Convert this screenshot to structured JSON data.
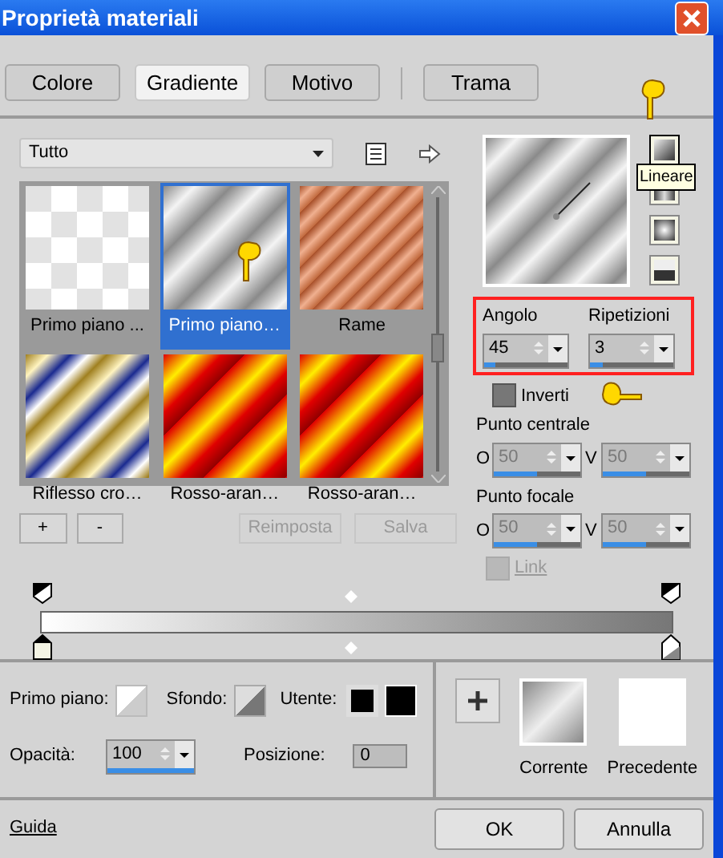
{
  "window": {
    "title": "Proprietà materiali"
  },
  "tabs": [
    {
      "label": "Colore",
      "selected": false
    },
    {
      "label": "Gradiente",
      "selected": true
    },
    {
      "label": "Motivo",
      "selected": false
    },
    {
      "label": "Trama",
      "selected": false
    }
  ],
  "category_dropdown": {
    "value": "Tutto"
  },
  "gradients": [
    {
      "label": "Primo piano ...",
      "selected": false,
      "kind": "checker"
    },
    {
      "label": "Primo piano…",
      "selected": true,
      "kind": "silver"
    },
    {
      "label": "Rame",
      "selected": false,
      "kind": "copper"
    },
    {
      "label": "Riflesso cro…",
      "selected": false,
      "kind": "chrome"
    },
    {
      "label": "Rosso-aran…",
      "selected": false,
      "kind": "fire"
    },
    {
      "label": "Rosso-aran…",
      "selected": false,
      "kind": "fire"
    }
  ],
  "gallery_buttons": [
    "+",
    "-"
  ],
  "preset_buttons": [
    {
      "label": "Reimposta",
      "disabled": true
    },
    {
      "label": "Salva",
      "disabled": true
    }
  ],
  "styles": [
    {
      "kind": "linear",
      "selected": true
    },
    {
      "kind": "rectangular",
      "selected": false
    },
    {
      "kind": "radial",
      "selected": false
    },
    {
      "kind": "sunburst",
      "selected": false
    }
  ],
  "tooltip": "Lineare",
  "angle": {
    "label": "Angolo",
    "value": "45",
    "level": 0.125
  },
  "repeats": {
    "label": "Ripetizioni",
    "value": "3",
    "level": 0.15
  },
  "invert": {
    "label": "Inverti",
    "checked": false
  },
  "center_point": {
    "label": "Punto centrale",
    "fields": [
      {
        "label": "O",
        "value": "50",
        "level": 0.5,
        "disabled": true
      },
      {
        "label": "V",
        "value": "50",
        "level": 0.5,
        "disabled": true
      }
    ]
  },
  "focal_point": {
    "label": "Punto focale",
    "fields": [
      {
        "label": "O",
        "value": "50",
        "level": 0.5,
        "disabled": true
      },
      {
        "label": "V",
        "value": "50",
        "level": 0.5,
        "disabled": true
      }
    ]
  },
  "link": {
    "label": "Link",
    "checked": false,
    "disabled": true
  },
  "foreground": {
    "label": "Primo piano:"
  },
  "background": {
    "label": "Sfondo:"
  },
  "user": {
    "label": "Utente:"
  },
  "opacity": {
    "label": "Opacità:",
    "value": "100",
    "level": 1
  },
  "position": {
    "label": "Posizione:",
    "value": "0"
  },
  "current": {
    "label": "Corrente"
  },
  "previous": {
    "label": "Precedente"
  },
  "help_link": "Guida",
  "buttons": [
    "OK",
    "Annulla"
  ]
}
